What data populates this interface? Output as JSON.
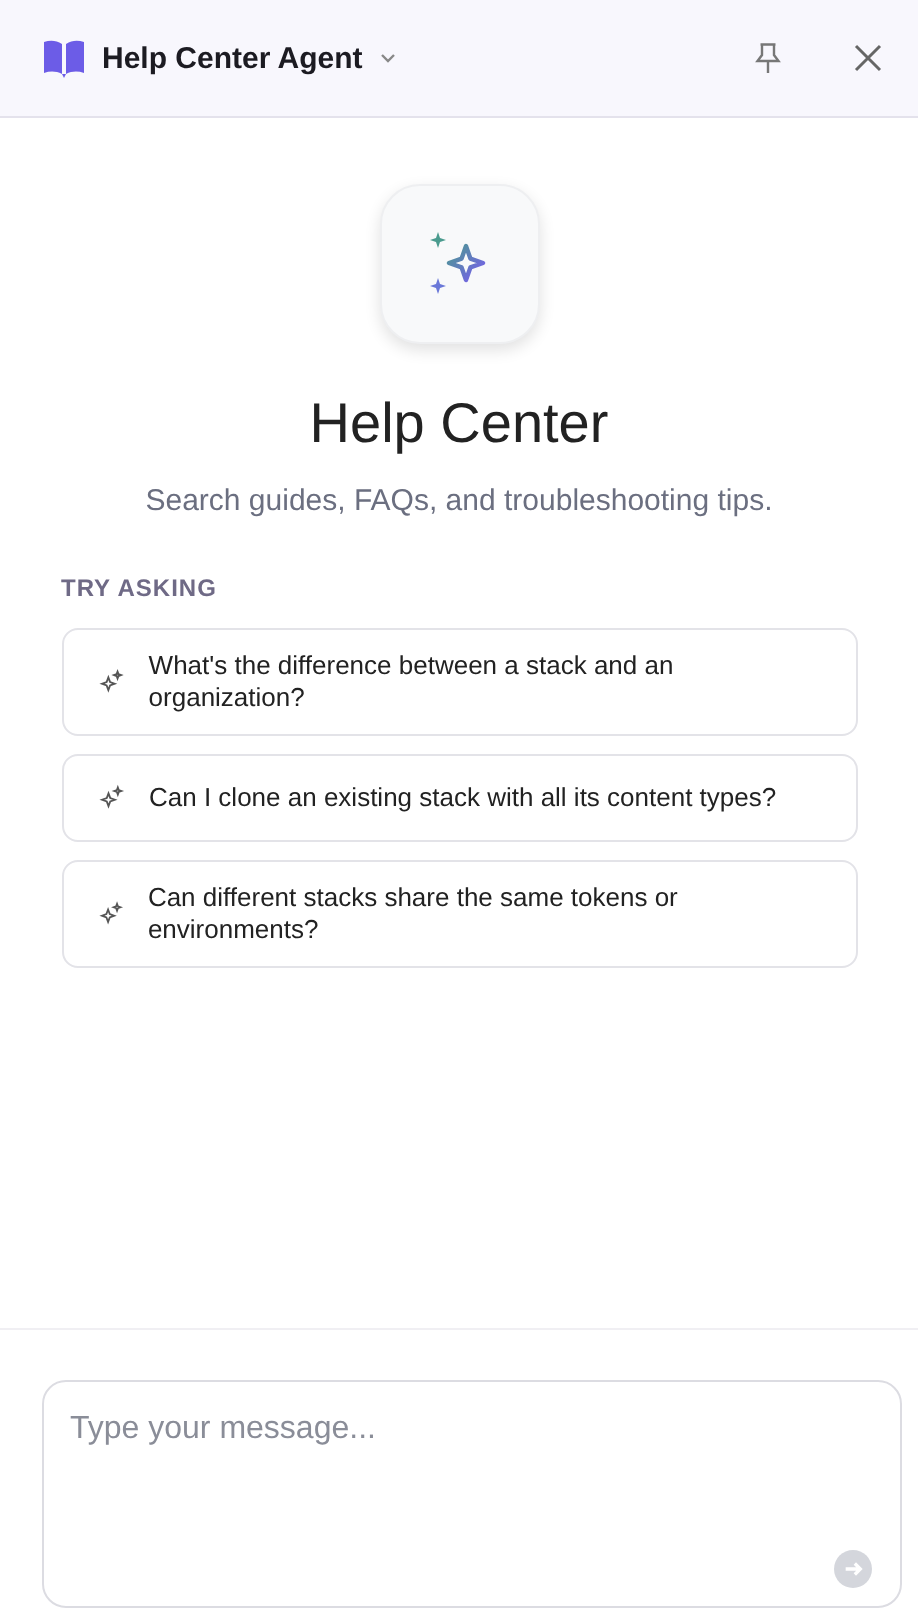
{
  "header": {
    "title": "Help Center Agent"
  },
  "hero": {
    "title": "Help Center",
    "subtitle": "Search guides, FAQs, and troubleshooting tips."
  },
  "suggestions": {
    "heading": "TRY ASKING",
    "items": [
      {
        "text": "What's the difference between a stack and an organization?"
      },
      {
        "text": "Can I clone an existing stack with all its content types?"
      },
      {
        "text": "Can different stacks share the same tokens or environments?"
      }
    ]
  },
  "composer": {
    "placeholder": "Type your message...",
    "send_disabled": true
  }
}
